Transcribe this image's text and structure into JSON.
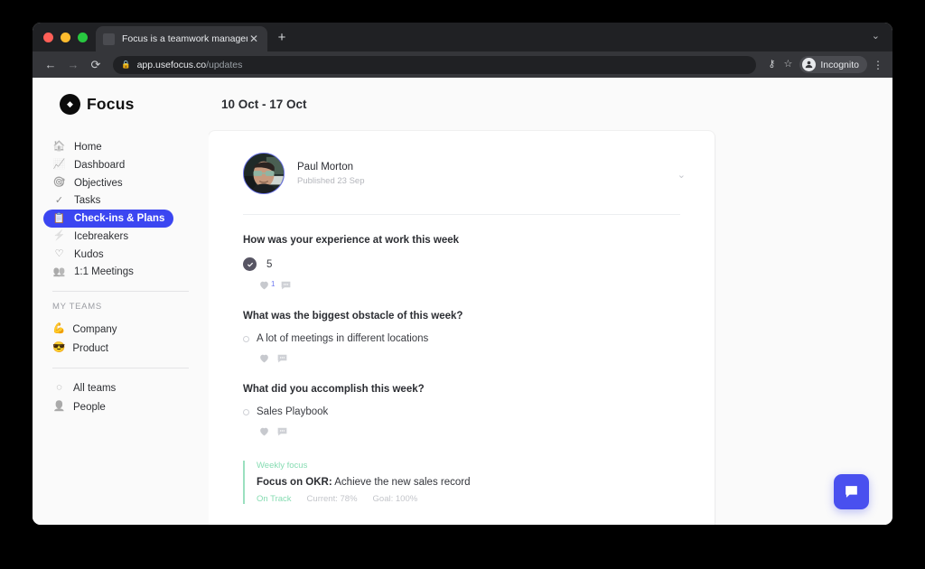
{
  "browser": {
    "tab_title": "Focus is a teamwork managem",
    "tab_close_glyph": "✕",
    "new_tab_glyph": "+",
    "window_chevron_glyph": "⌄",
    "back_glyph": "←",
    "forward_glyph": "→",
    "reload_glyph": "⟳",
    "lock_glyph": "🔒",
    "url_host": "app.usefocus.co",
    "url_path": "/updates",
    "key_icon_glyph": "⚷",
    "star_glyph": "☆",
    "incognito_label": "Incognito",
    "incognito_glyph": "👤",
    "menu_glyph": "⋮"
  },
  "sidebar": {
    "brand": "Focus",
    "nav": [
      {
        "label": "Home",
        "icon": "🏠",
        "icon_name": "home-icon",
        "active": false
      },
      {
        "label": "Dashboard",
        "icon": "📈",
        "icon_name": "dashboard-icon",
        "active": false
      },
      {
        "label": "Objectives",
        "icon": "🎯",
        "icon_name": "target-icon",
        "active": false
      },
      {
        "label": "Tasks",
        "icon": "✓",
        "icon_name": "check-circle-icon",
        "active": false
      },
      {
        "label": "Check-ins & Plans",
        "icon": "📋",
        "icon_name": "clipboard-icon",
        "active": true
      },
      {
        "label": "Icebreakers",
        "icon": "⚡",
        "icon_name": "lightning-icon",
        "active": false
      },
      {
        "label": "Kudos",
        "icon": "♡",
        "icon_name": "heart-outline-icon",
        "active": false
      },
      {
        "label": "1:1 Meetings",
        "icon": "👥",
        "icon_name": "people-icon",
        "active": false
      }
    ],
    "section_label": "MY TEAMS",
    "teams": [
      {
        "label": "Company",
        "emoji": "💪"
      },
      {
        "label": "Product",
        "emoji": "😎"
      }
    ],
    "footer": [
      {
        "label": "All teams",
        "icon": "◌",
        "icon_name": "all-teams-icon"
      },
      {
        "label": "People",
        "icon": "👤",
        "icon_name": "person-icon"
      }
    ]
  },
  "main": {
    "page_title": "10 Oct - 17 Oct",
    "card": {
      "author_name": "Paul Morton",
      "published": "Published 23 Sep",
      "chevron_glyph": "⌄",
      "entries": [
        {
          "question": "How was your experience at work this week",
          "answer": "5",
          "answer_kind": "score",
          "heart_count": "1",
          "has_comment": true
        },
        {
          "question": "What was the biggest obstacle of this week?",
          "answer": "A lot of meetings in different locations",
          "answer_kind": "bullet",
          "heart_count": "",
          "has_comment": true
        },
        {
          "question": "What did you accomplish this week?",
          "answer": "Sales Playbook",
          "answer_kind": "bullet",
          "heart_count": "",
          "has_comment": true
        }
      ],
      "weekly_focus": {
        "label": "Weekly focus",
        "title_bold": "Focus on OKR:",
        "title_rest": " Achieve the new sales record",
        "status": "On Track",
        "current": "Current: 78%",
        "goal": "Goal: 100%"
      }
    }
  },
  "chat": {
    "name": "chat-widget"
  },
  "colors": {
    "accent_blue": "#3b46f1",
    "chat_blue": "#4950ef",
    "green": "#86dcb2",
    "page_bg": "#fafafa"
  }
}
